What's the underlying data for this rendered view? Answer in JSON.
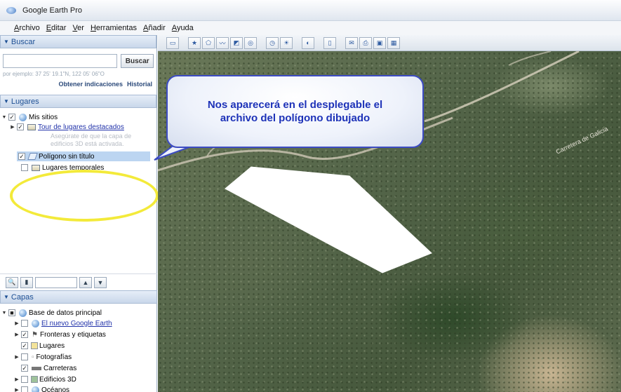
{
  "window": {
    "title": "Google Earth Pro"
  },
  "menu": [
    "Archivo",
    "Editar",
    "Ver",
    "Herramientas",
    "Añadir",
    "Ayuda"
  ],
  "search": {
    "header": "Buscar",
    "button": "Buscar",
    "placeholder": "",
    "hint": "por ejemplo: 37 25' 19.1\"N, 122 05' 06\"O",
    "link_directions": "Obtener indicaciones",
    "link_history": "Historial"
  },
  "places": {
    "header": "Lugares",
    "items": [
      {
        "label": "Mis sitios"
      },
      {
        "label": "Tour de lugares destacados"
      },
      {
        "label": "Asegúrate de que la capa de"
      },
      {
        "label": "edificios 3D está activada."
      },
      {
        "label": "Polígono sin título"
      },
      {
        "label": "Lugares temporales"
      }
    ]
  },
  "layers": {
    "header": "Capas",
    "items": [
      {
        "label": "Base de datos principal"
      },
      {
        "label": "El nuevo Google Earth"
      },
      {
        "label": "Fronteras y etiquetas"
      },
      {
        "label": "Lugares"
      },
      {
        "label": "Fotografías"
      },
      {
        "label": "Carreteras"
      },
      {
        "label": "Edificios 3D"
      },
      {
        "label": "Océanos"
      }
    ]
  },
  "callout": {
    "text": "Nos aparecerá en el desplegable el\narchivo del polígono dibujado"
  },
  "map": {
    "road_label": "Carretera de Galicia"
  },
  "colors": {
    "callout_border": "#3c4bc2",
    "callout_text": "#1d32b8",
    "highlight": "#f3ea3a"
  }
}
